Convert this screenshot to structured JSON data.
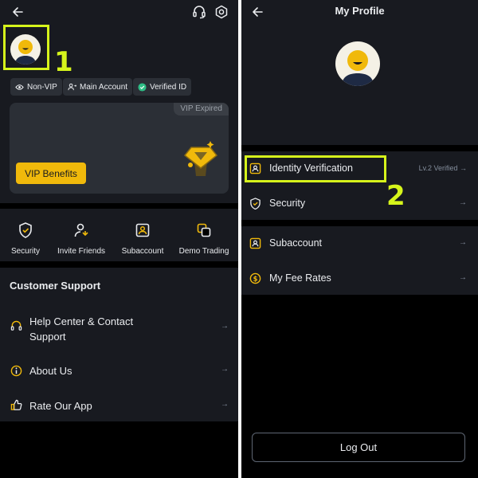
{
  "left": {
    "header": {
      "back_icon": "arrow-left-icon",
      "support_icon": "headset-icon",
      "settings_icon": "gear-icon"
    },
    "annotation_number": "1",
    "chips": {
      "non_vip": "Non-VIP",
      "main_account": "Main Account",
      "verified_id": "Verified ID"
    },
    "vip_card": {
      "expired_label": "VIP Expired",
      "button_label": "VIP Benefits"
    },
    "quick_actions": [
      {
        "label": "Security",
        "icon": "shield-icon"
      },
      {
        "label": "Invite Friends",
        "icon": "invite-user-icon"
      },
      {
        "label": "Subaccount",
        "icon": "id-card-icon"
      },
      {
        "label": "Demo Trading",
        "icon": "demo-trading-icon"
      }
    ],
    "support": {
      "title": "Customer Support",
      "items": [
        {
          "label_line1": "Help Center & Contact",
          "label_line2": "Support",
          "icon": "headset-icon"
        },
        {
          "label_line1": "About Us",
          "icon": "info-icon"
        },
        {
          "label_line1": "Rate Our App",
          "icon": "thumbs-up-icon"
        }
      ]
    }
  },
  "right": {
    "header": {
      "title": "My Profile",
      "back_icon": "arrow-left-icon"
    },
    "annotation_number": "2",
    "items": [
      {
        "label": "Identity Verification",
        "hint": "Lv.2 Verified",
        "icon": "id-badge-icon"
      },
      {
        "label": "Security",
        "icon": "shield-icon"
      },
      {
        "label": "Subaccount",
        "icon": "id-card-icon"
      },
      {
        "label": "My Fee Rates",
        "icon": "dollar-coin-icon"
      }
    ],
    "logout_label": "Log Out"
  },
  "colors": {
    "accent": "#f0b90b",
    "annotation": "#d6f51b",
    "surface": "#181a20",
    "card": "#2b2f36",
    "verified": "#2ebd85"
  }
}
